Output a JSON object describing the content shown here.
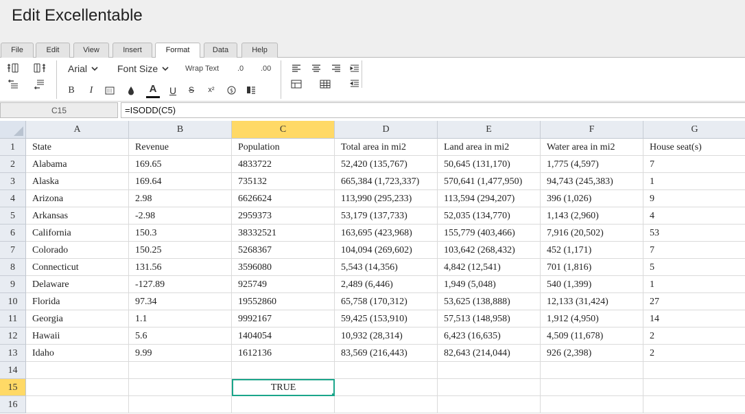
{
  "app": {
    "title": "Edit Excellentable"
  },
  "menu_tabs": [
    {
      "label": "File"
    },
    {
      "label": "Edit"
    },
    {
      "label": "View"
    },
    {
      "label": "Insert"
    },
    {
      "label": "Format"
    },
    {
      "label": "Data"
    },
    {
      "label": "Help"
    }
  ],
  "active_tab": "Format",
  "ribbon": {
    "font_name": "Arial",
    "font_size": "Font Size",
    "wrap_text": "Wrap Text",
    "dec_decrease": ".0",
    "dec_increase": ".00",
    "bold": "B",
    "italic": "I",
    "underline": "U",
    "strike": "S",
    "superscript": "x²",
    "font_color_glyph": "A"
  },
  "formula_bar": {
    "cell_ref": "C15",
    "formula": "=ISODD(C5)"
  },
  "sheet": {
    "columns": [
      "A",
      "B",
      "C",
      "D",
      "E",
      "F",
      "G"
    ],
    "selected_column": "C",
    "selected_row": "15",
    "row_numbers": [
      "1",
      "2",
      "3",
      "4",
      "5",
      "6",
      "7",
      "8",
      "9",
      "10",
      "11",
      "12",
      "13",
      "14",
      "15",
      "16"
    ],
    "rows": [
      [
        "State",
        "Revenue",
        "Population",
        "Total area in mi2",
        "Land area in mi2",
        "Water area in mi2",
        "House seat(s)"
      ],
      [
        "Alabama",
        "169.65",
        "4833722",
        "52,420 (135,767)",
        "50,645 (131,170)",
        "1,775 (4,597)",
        "7"
      ],
      [
        "Alaska",
        "169.64",
        "735132",
        "665,384 (1,723,337)",
        "570,641 (1,477,950)",
        "94,743 (245,383)",
        "1"
      ],
      [
        "Arizona",
        "2.98",
        "6626624",
        "113,990 (295,233)",
        "113,594 (294,207)",
        "396 (1,026)",
        "9"
      ],
      [
        "Arkansas",
        "-2.98",
        "2959373",
        "53,179 (137,733)",
        "52,035 (134,770)",
        "1,143 (2,960)",
        "4"
      ],
      [
        "California",
        "150.3",
        "38332521",
        "163,695 (423,968)",
        "155,779 (403,466)",
        "7,916 (20,502)",
        "53"
      ],
      [
        "Colorado",
        "150.25",
        "5268367",
        "104,094 (269,602)",
        "103,642 (268,432)",
        "452 (1,171)",
        "7"
      ],
      [
        "Connecticut",
        "131.56",
        "3596080",
        "5,543 (14,356)",
        "4,842 (12,541)",
        "701 (1,816)",
        "5"
      ],
      [
        "Delaware",
        "-127.89",
        "925749",
        "2,489 (6,446)",
        "1,949 (5,048)",
        "540 (1,399)",
        "1"
      ],
      [
        "Florida",
        "97.34",
        "19552860",
        "65,758 (170,312)",
        "53,625 (138,888)",
        "12,133 (31,424)",
        "27"
      ],
      [
        "Georgia",
        "1.1",
        "9992167",
        "59,425 (153,910)",
        "57,513 (148,958)",
        "1,912 (4,950)",
        "14"
      ],
      [
        "Hawaii",
        "5.6",
        "1404054",
        "10,932 (28,314)",
        "6,423 (16,635)",
        "4,509 (11,678)",
        "2"
      ],
      [
        "Idaho",
        "9.99",
        "1612136",
        "83,569 (216,443)",
        "82,643 (214,044)",
        "926 (2,398)",
        "2"
      ],
      [
        "",
        "",
        "",
        "",
        "",
        "",
        ""
      ],
      [
        "",
        "",
        "TRUE",
        "",
        "",
        "",
        ""
      ],
      [
        "",
        "",
        "",
        "",
        "",
        "",
        ""
      ]
    ]
  },
  "colors": {
    "accent": "#1aa58a",
    "header_selected": "#ffd966",
    "header_bg": "#e8ecf2"
  }
}
